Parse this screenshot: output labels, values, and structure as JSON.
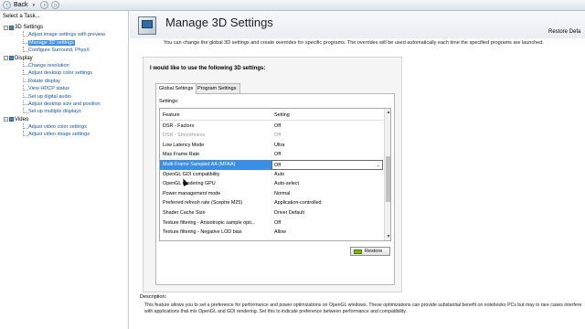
{
  "toolbar": {
    "back_label": "Back",
    "back_icon": "arrow-left-icon",
    "forward_icon": "arrow-right-icon",
    "home_icon": "home-icon"
  },
  "sidebar": {
    "title": "Select a Task...",
    "categories": [
      {
        "label": "3D Settings",
        "items": [
          "Adjust image settings with preview",
          "Manage 3D settings",
          "Configure Surround, PhysX"
        ]
      },
      {
        "label": "Display",
        "items": [
          "Change resolution",
          "Adjust desktop color settings",
          "Rotate display",
          "View HDCP status",
          "Set up digital audio",
          "Adjust desktop size and position",
          "Set up multiple displays"
        ]
      },
      {
        "label": "Video",
        "items": [
          "Adjust video color settings",
          "Adjust video image settings"
        ]
      }
    ],
    "selected_item": "Manage 3D settings"
  },
  "header": {
    "title": "Manage 3D Settings",
    "restore_defaults": "Restore Defa"
  },
  "main": {
    "intro": "You can change the global 3D settings and create overrides for specific programs. The overrides will be used automatically each time the specified programs are launched.",
    "panel_label": "I would like to use the following 3D settings:",
    "tabs": [
      "Global Settings",
      "Program Settings"
    ],
    "active_tab": "Global Settings",
    "settings_label": "Settings:",
    "grid": {
      "columns": [
        "Feature",
        "Setting"
      ],
      "rows": [
        {
          "feature": "DSR - Factors",
          "setting": "Off",
          "state": "normal"
        },
        {
          "feature": "DSR - Smoothness",
          "setting": "Off",
          "state": "disabled"
        },
        {
          "feature": "Low Latency Mode",
          "setting": "Ultra",
          "state": "normal"
        },
        {
          "feature": "Max Frame Rate",
          "setting": "Off",
          "state": "normal"
        },
        {
          "feature": "Multi-Frame Sampled AA (MFAA)",
          "setting": "Off",
          "state": "selected"
        },
        {
          "feature": "OpenGL GDI compatibility",
          "setting": "Auto",
          "state": "normal"
        },
        {
          "feature": "OpenGL rendering GPU",
          "setting": "Auto-select",
          "state": "normal"
        },
        {
          "feature": "Power management mode",
          "setting": "Normal",
          "state": "normal"
        },
        {
          "feature": "Preferred refresh rate (Sceptre M25)",
          "setting": "Application-controlled",
          "state": "normal"
        },
        {
          "feature": "Shader Cache Size",
          "setting": "Driver Default",
          "state": "normal"
        },
        {
          "feature": "Texture filtering - Anisotropic sample opti...",
          "setting": "Off",
          "state": "normal"
        },
        {
          "feature": "Texture filtering - Negative LOD bias",
          "setting": "Allow",
          "state": "normal"
        }
      ]
    },
    "restore_button": "Restore"
  },
  "description": {
    "label": "Description:",
    "text": "This feature allows you to set a preference for performance and power optimizations on OpenGL windows. These optimizations can provide substantial benefit on notebooks PCs but may in rare cases interfere with applications that mix OpenGL and GDI rendering. Set this to indicate preference between performance and compatibility."
  }
}
